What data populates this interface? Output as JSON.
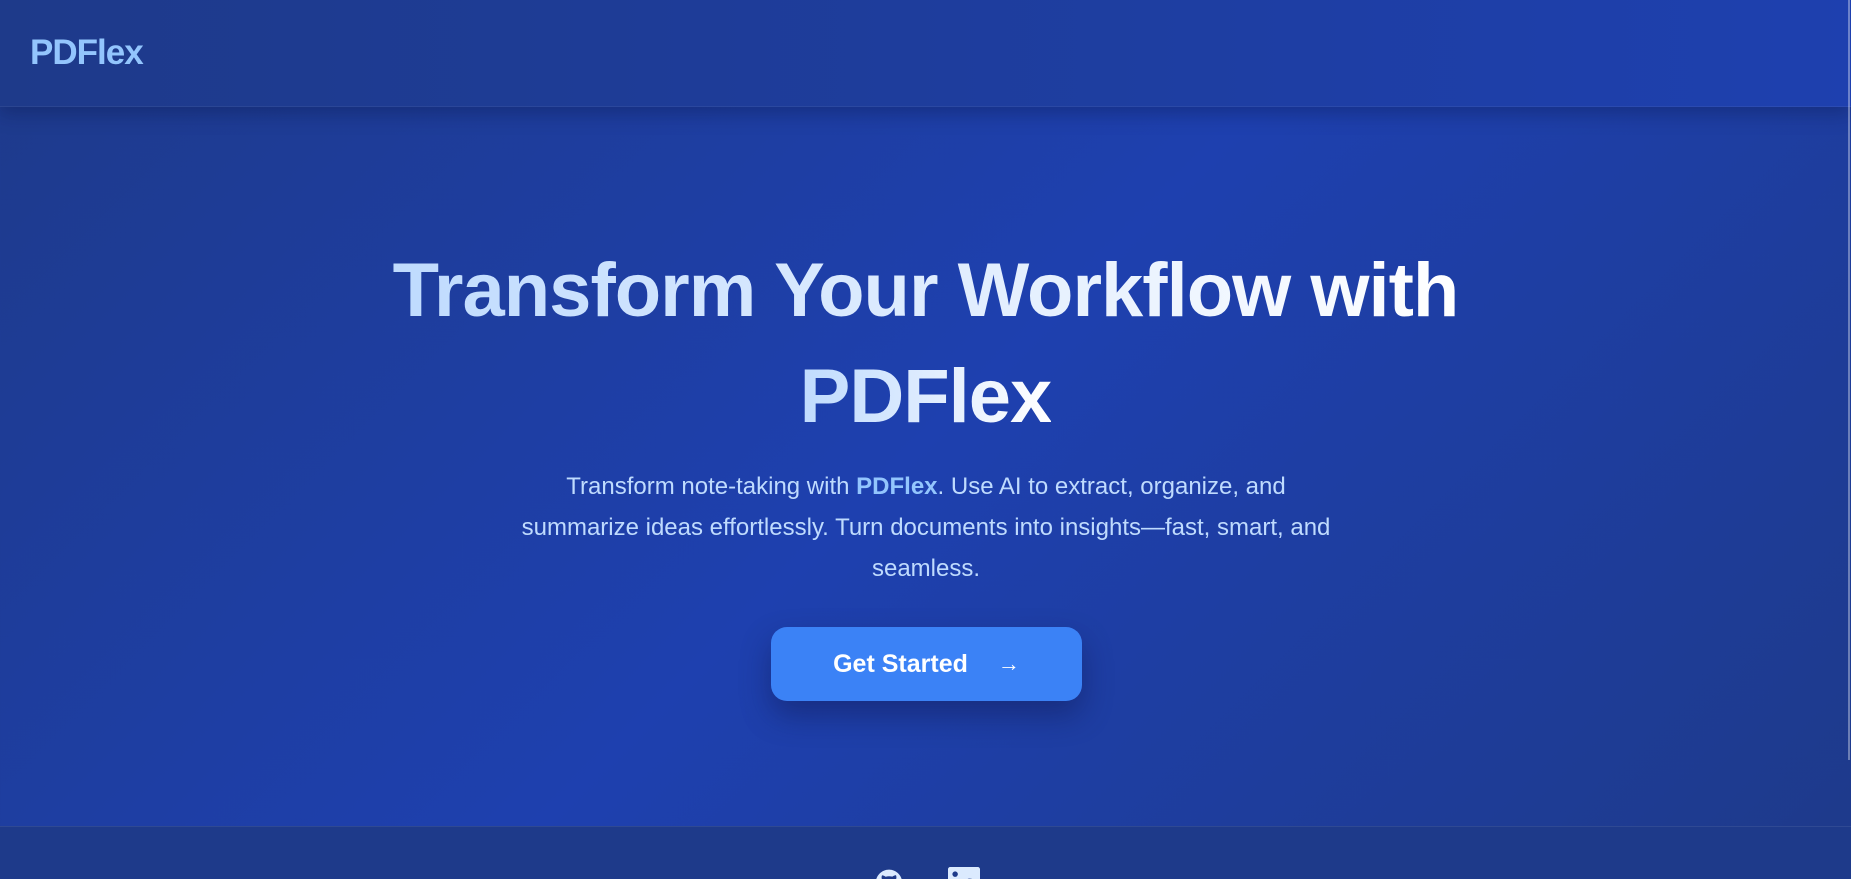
{
  "header": {
    "logo": "PDFlex"
  },
  "hero": {
    "headline_line1": "Transform Your Workflow with",
    "headline_line2": "PDFlex",
    "subtext_before": "Transform note-taking with ",
    "subtext_brand": "PDFlex",
    "subtext_after": ". Use AI to extract, organize, and summarize ideas effortlessly. Turn documents into insights—fast, smart, and seamless.",
    "cta_label": "Get Started",
    "cta_icon": "arrow-right-icon"
  },
  "footer": {
    "icons": [
      "github-icon",
      "linkedin-icon"
    ]
  },
  "colors": {
    "background": "#1e40af",
    "accent": "#3b82f6",
    "logo": "#93c5fd",
    "text_muted": "#bfdbfe"
  }
}
